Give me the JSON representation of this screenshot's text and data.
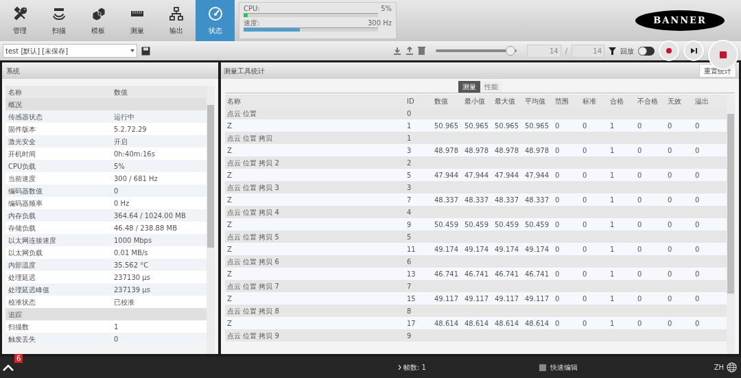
{
  "nav": [
    {
      "label": "管理",
      "selected": false
    },
    {
      "label": "扫描",
      "selected": false
    },
    {
      "label": "模板",
      "selected": false
    },
    {
      "label": "测量",
      "selected": false
    },
    {
      "label": "输出",
      "selected": false
    },
    {
      "label": "状态",
      "selected": true
    }
  ],
  "meters": [
    {
      "label": "CPU:",
      "reading": "5%",
      "level": 0.03,
      "color": "#22c55e"
    },
    {
      "label": "速度:",
      "reading": "300 Hz",
      "level": 0.42,
      "color": "#4a9fd4"
    }
  ],
  "logo": "BANNER",
  "toolbar": {
    "job": "test [默认] [未保存]",
    "playback": {
      "level": 0.93
    },
    "frame": "14",
    "total": "14",
    "separator": "/",
    "replay_label": "回放",
    "replay_on": false
  },
  "system_panel": {
    "title": "系统",
    "columns": [
      "名称",
      "数值"
    ],
    "rows": [
      {
        "kind": "group",
        "name": "概况"
      },
      {
        "kind": "value",
        "name": "传感器状态",
        "value": "运行中"
      },
      {
        "kind": "value",
        "name": "固件版本",
        "value": "5.2.72.29"
      },
      {
        "kind": "value",
        "name": "激光安全",
        "value": "开启"
      },
      {
        "kind": "value",
        "name": "开机时间",
        "value": "0h:40m:16s"
      },
      {
        "kind": "value",
        "name": "CPU负载",
        "value": "5%"
      },
      {
        "kind": "value",
        "name": "当前速度",
        "value": "300 / 681 Hz"
      },
      {
        "kind": "value",
        "name": "编码器数值",
        "value": "0"
      },
      {
        "kind": "value",
        "name": "编码器频率",
        "value": "0 Hz"
      },
      {
        "kind": "value",
        "name": "内存负载",
        "value": "364.64 / 1024.00 MB"
      },
      {
        "kind": "value",
        "name": "存储负载",
        "value": "46.48 / 238.88 MB"
      },
      {
        "kind": "value",
        "name": "以太网连接速度",
        "value": "1000 Mbps"
      },
      {
        "kind": "value",
        "name": "以太网负载",
        "value": "0.01 MB/s"
      },
      {
        "kind": "value",
        "name": "内部温度",
        "value": "35.562 °C"
      },
      {
        "kind": "value",
        "name": "处理延迟",
        "value": "237130 µs"
      },
      {
        "kind": "value",
        "name": "处理延迟峰值",
        "value": "237139 µs"
      },
      {
        "kind": "value",
        "name": "校准状态",
        "value": "已校准"
      },
      {
        "kind": "group",
        "name": "追踪"
      },
      {
        "kind": "value",
        "name": "扫描数",
        "value": "1"
      },
      {
        "kind": "value",
        "name": "触发丢失",
        "value": "0"
      }
    ]
  },
  "stats_panel": {
    "title": "测量工具统计",
    "reset_button": "重置统计",
    "tabs": [
      {
        "label": "测量",
        "selected": true
      },
      {
        "label": "性能",
        "selected": false
      }
    ],
    "columns": [
      "名称",
      "ID",
      "数值",
      "最小值",
      "最大值",
      "平均值",
      "范围",
      "标准",
      "合格",
      "不合格",
      "无效",
      "溢出"
    ],
    "rows": [
      {
        "kind": "group",
        "cells": [
          "点云 位置",
          "0"
        ]
      },
      {
        "kind": "value",
        "cells": [
          "Z",
          "1",
          "50.965",
          "50.965",
          "50.965",
          "50.965",
          "0",
          "0",
          "1",
          "0",
          "0",
          "0"
        ]
      },
      {
        "kind": "group",
        "cells": [
          "点云 位置 拷贝",
          "1"
        ]
      },
      {
        "kind": "value",
        "cells": [
          "Z",
          "3",
          "48.978",
          "48.978",
          "48.978",
          "48.978",
          "0",
          "0",
          "1",
          "0",
          "0",
          "0"
        ]
      },
      {
        "kind": "group",
        "cells": [
          "点云 位置 拷贝 2",
          "2"
        ]
      },
      {
        "kind": "value",
        "cells": [
          "Z",
          "5",
          "47.944",
          "47.944",
          "47.944",
          "47.944",
          "0",
          "0",
          "1",
          "0",
          "0",
          "0"
        ]
      },
      {
        "kind": "group",
        "cells": [
          "点云 位置 拷贝 3",
          "3"
        ]
      },
      {
        "kind": "value",
        "cells": [
          "Z",
          "7",
          "48.337",
          "48.337",
          "48.337",
          "48.337",
          "0",
          "0",
          "1",
          "0",
          "0",
          "0"
        ]
      },
      {
        "kind": "group",
        "cells": [
          "点云 位置 拷贝 4",
          "4"
        ]
      },
      {
        "kind": "value",
        "cells": [
          "Z",
          "9",
          "50.459",
          "50.459",
          "50.459",
          "50.459",
          "0",
          "0",
          "1",
          "0",
          "0",
          "0"
        ]
      },
      {
        "kind": "group",
        "cells": [
          "点云 位置 拷贝 5",
          "5"
        ]
      },
      {
        "kind": "value",
        "cells": [
          "Z",
          "11",
          "49.174",
          "49.174",
          "49.174",
          "49.174",
          "0",
          "0",
          "1",
          "0",
          "0",
          "0"
        ]
      },
      {
        "kind": "group",
        "cells": [
          "点云 位置 拷贝 6",
          "6"
        ]
      },
      {
        "kind": "value",
        "cells": [
          "Z",
          "13",
          "46.741",
          "46.741",
          "46.741",
          "46.741",
          "0",
          "0",
          "1",
          "0",
          "0",
          "0"
        ]
      },
      {
        "kind": "group",
        "cells": [
          "点云 位置 拷贝 7",
          "7"
        ]
      },
      {
        "kind": "value",
        "cells": [
          "Z",
          "15",
          "49.117",
          "49.117",
          "49.117",
          "49.117",
          "0",
          "0",
          "1",
          "0",
          "0",
          "0"
        ]
      },
      {
        "kind": "group",
        "cells": [
          "点云 位置 拷贝 8",
          "8"
        ]
      },
      {
        "kind": "value",
        "cells": [
          "Z",
          "17",
          "48.614",
          "48.614",
          "48.614",
          "48.614",
          "0",
          "0",
          "1",
          "0",
          "0",
          "0"
        ]
      },
      {
        "kind": "group",
        "cells": [
          "点云 位置 拷贝 9",
          "9"
        ]
      }
    ]
  },
  "status_bar": {
    "badge": "6",
    "frames": "帧数: 1",
    "quick_edit": {
      "label": "快速编辑",
      "checked": false
    },
    "language": "ZH"
  }
}
